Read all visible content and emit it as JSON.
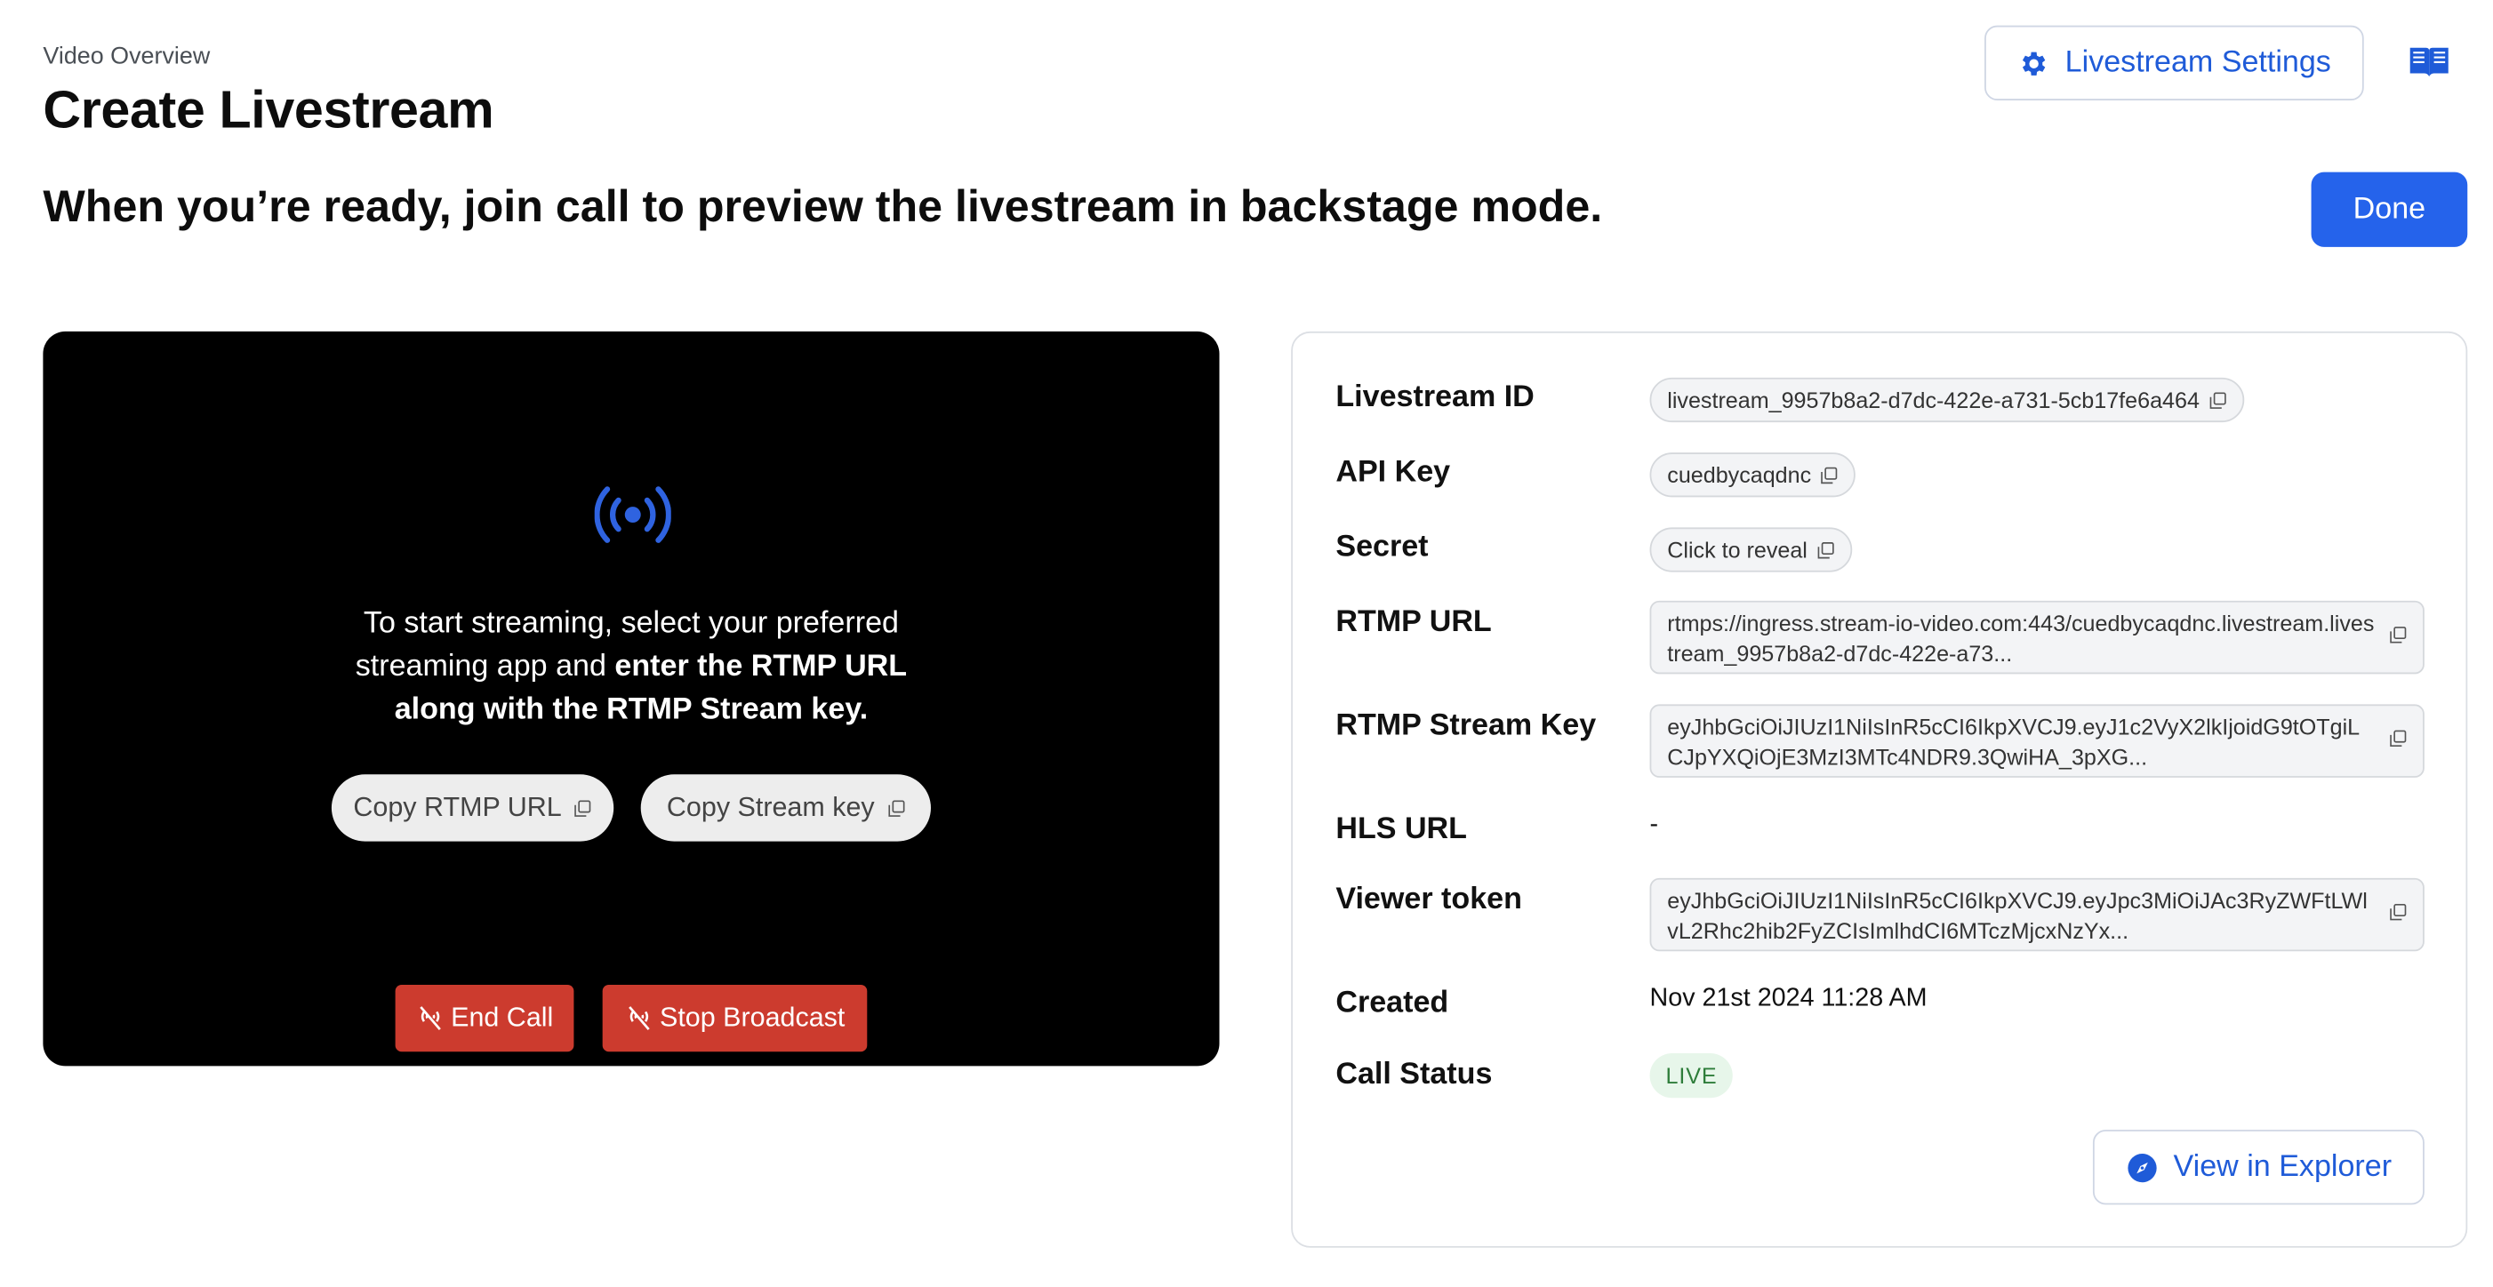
{
  "header": {
    "breadcrumb": "Video Overview",
    "title": "Create Livestream",
    "settings_label": "Livestream Settings",
    "subtitle": "When you’re ready, join call to preview the livestream in backstage mode.",
    "done_label": "Done"
  },
  "preview": {
    "message_plain": "To start streaming, select your preferred streaming app and ",
    "message_bold": "enter the RTMP URL along with the RTMP Stream key.",
    "copy_rtmp_label": "Copy RTMP URL",
    "copy_key_label": "Copy Stream key",
    "end_call_label": "End Call",
    "stop_broadcast_label": "Stop Broadcast"
  },
  "details": {
    "livestream_id_label": "Livestream ID",
    "livestream_id_value": "livestream_9957b8a2-d7dc-422e-a731-5cb17fe6a464",
    "api_key_label": "API Key",
    "api_key_value": "cuedbycaqdnc",
    "secret_label": "Secret",
    "secret_value": "Click to reveal",
    "rtmp_url_label": "RTMP URL",
    "rtmp_url_value": "rtmps://ingress.stream-io-video.com:443/cuedbycaqdnc.livestream.livestream_9957b8a2-d7dc-422e-a73...",
    "rtmp_key_label": "RTMP Stream Key",
    "rtmp_key_value": "eyJhbGciOiJIUzI1NiIsInR5cCI6IkpXVCJ9.eyJ1c2VyX2lkIjoidG9tOTgiLCJpYXQiOjE3MzI3MTc4NDR9.3QwiHA_3pXG...",
    "hls_url_label": "HLS URL",
    "hls_url_value": "-",
    "viewer_token_label": "Viewer token",
    "viewer_token_value": "eyJhbGciOiJIUzI1NiIsInR5cCI6IkpXVCJ9.eyJpc3MiOiJAc3RyZWFtLWlvL2Rhc2hib2FyZCIsImlhdCI6MTczMjcxNzYx...",
    "created_label": "Created",
    "created_value": "Nov 21st 2024 11:28 AM",
    "status_label": "Call Status",
    "status_value": "LIVE",
    "explorer_label": "View in Explorer"
  },
  "colors": {
    "accent": "#2563eb",
    "danger": "#cc3b2e",
    "live_bg": "#e7f6ea",
    "live_fg": "#2e7d3a"
  },
  "icons": [
    "gear-icon",
    "book-icon",
    "broadcast-icon",
    "copy-icon",
    "call-off-icon",
    "compass-icon"
  ]
}
